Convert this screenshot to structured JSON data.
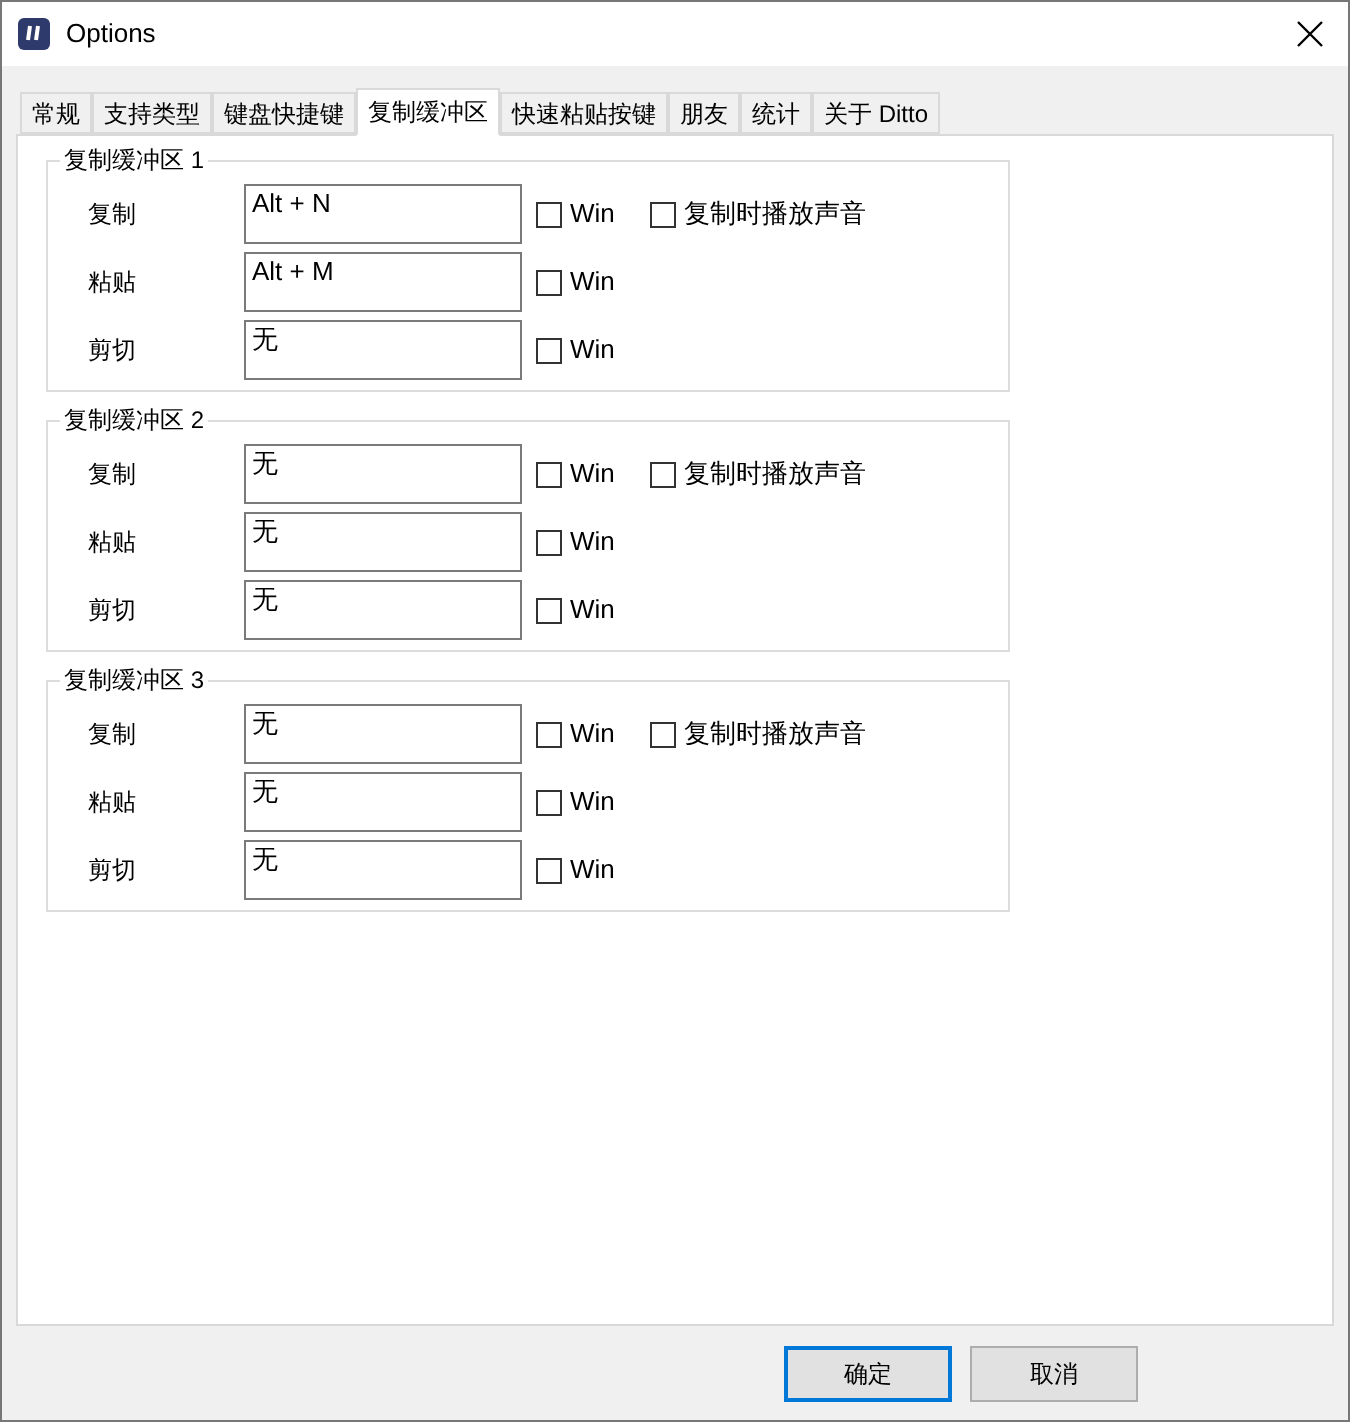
{
  "window": {
    "title": "Options"
  },
  "tabs": [
    {
      "label": "常规",
      "selected": false
    },
    {
      "label": "支持类型",
      "selected": false
    },
    {
      "label": "键盘快捷键",
      "selected": false
    },
    {
      "label": "复制缓冲区",
      "selected": true
    },
    {
      "label": "快速粘贴按键",
      "selected": false
    },
    {
      "label": "朋友",
      "selected": false
    },
    {
      "label": "统计",
      "selected": false
    },
    {
      "label": "关于 Ditto",
      "selected": false
    }
  ],
  "groups": [
    {
      "title": "复制缓冲区 1",
      "rows": [
        {
          "label": "复制",
          "value": "Alt + N",
          "win": {
            "label": "Win",
            "checked": false
          },
          "sound": {
            "label": "复制时播放声音",
            "checked": false
          }
        },
        {
          "label": "粘贴",
          "value": "Alt + M",
          "win": {
            "label": "Win",
            "checked": false
          }
        },
        {
          "label": "剪切",
          "value": "无",
          "win": {
            "label": "Win",
            "checked": false
          }
        }
      ]
    },
    {
      "title": "复制缓冲区 2",
      "rows": [
        {
          "label": "复制",
          "value": "无",
          "win": {
            "label": "Win",
            "checked": false
          },
          "sound": {
            "label": "复制时播放声音",
            "checked": false
          }
        },
        {
          "label": "粘贴",
          "value": "无",
          "win": {
            "label": "Win",
            "checked": false
          }
        },
        {
          "label": "剪切",
          "value": "无",
          "win": {
            "label": "Win",
            "checked": false
          }
        }
      ]
    },
    {
      "title": "复制缓冲区 3",
      "rows": [
        {
          "label": "复制",
          "value": "无",
          "win": {
            "label": "Win",
            "checked": false
          },
          "sound": {
            "label": "复制时播放声音",
            "checked": false
          }
        },
        {
          "label": "粘贴",
          "value": "无",
          "win": {
            "label": "Win",
            "checked": false
          }
        },
        {
          "label": "剪切",
          "value": "无",
          "win": {
            "label": "Win",
            "checked": false
          }
        }
      ]
    }
  ],
  "buttons": [
    {
      "label": "确定",
      "default": true
    },
    {
      "label": "取消",
      "default": false
    }
  ]
}
